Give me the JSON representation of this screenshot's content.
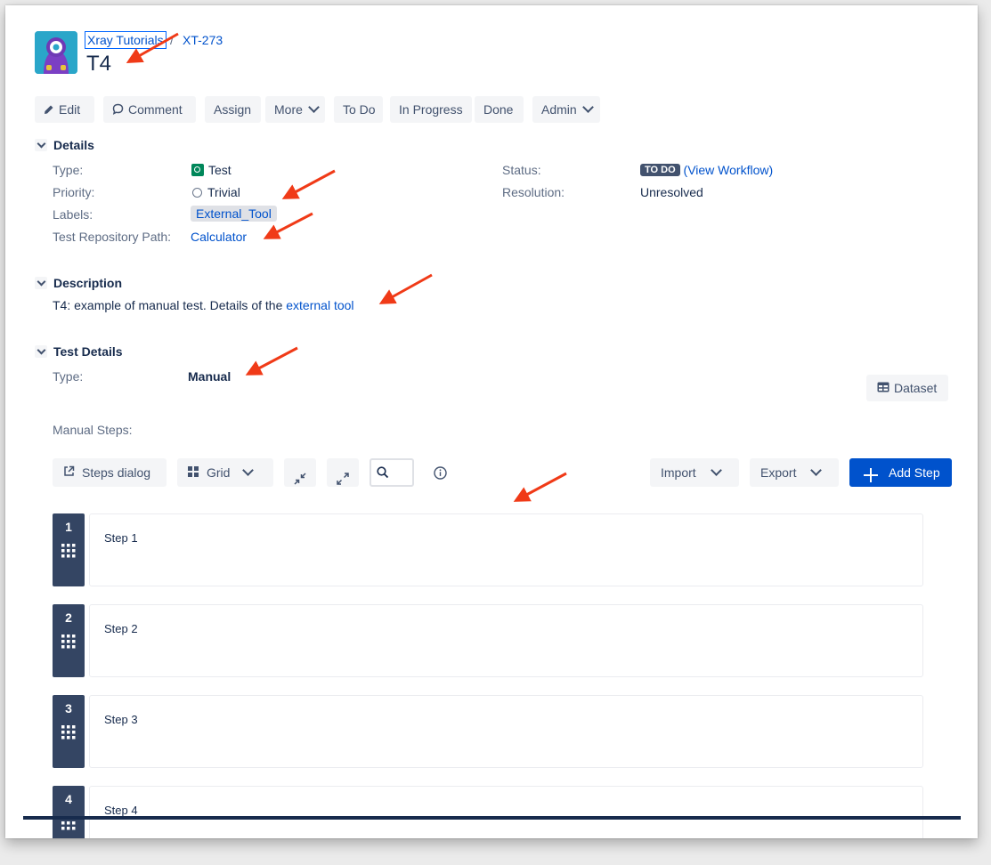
{
  "breadcrumb": {
    "project": "Xray Tutorials",
    "separator": "/",
    "issue_key": "XT-273"
  },
  "issue": {
    "title": "T4"
  },
  "toolbar": {
    "edit": "Edit",
    "comment": "Comment",
    "assign": "Assign",
    "more": "More",
    "todo": "To Do",
    "in_progress": "In Progress",
    "done": "Done",
    "admin": "Admin"
  },
  "details": {
    "heading": "Details",
    "type_label": "Type:",
    "type_value": "Test",
    "priority_label": "Priority:",
    "priority_value": "Trivial",
    "labels_label": "Labels:",
    "labels_value": "External_Tool",
    "repo_label": "Test Repository Path:",
    "repo_value": "Calculator",
    "status_label": "Status:",
    "status_lozenge": "TO DO",
    "status_open": "(",
    "status_link": "View Workflow",
    "status_close": ")",
    "resolution_label": "Resolution:",
    "resolution_value": "Unresolved"
  },
  "description": {
    "heading": "Description",
    "text": "T4: example of manual test. Details of the ",
    "link": "external tool"
  },
  "test_details": {
    "heading": "Test Details",
    "type_label": "Type:",
    "type_value": "Manual",
    "dataset": "Dataset",
    "manual_steps_label": "Manual Steps:"
  },
  "steps_toolbar": {
    "steps_dialog": "Steps dialog",
    "grid": "Grid",
    "import": "Import",
    "export": "Export",
    "add_step": "Add Step"
  },
  "steps": [
    {
      "number": "1",
      "action": "Step 1"
    },
    {
      "number": "2",
      "action": "Step 2"
    },
    {
      "number": "3",
      "action": "Step 3"
    },
    {
      "number": "4",
      "action": "Step 4"
    }
  ],
  "colors": {
    "link": "#0052cc",
    "primary_button": "#0052cc",
    "step_badge": "#344563",
    "annotation_arrow": "#f03a17",
    "test_type": "#00875a"
  }
}
